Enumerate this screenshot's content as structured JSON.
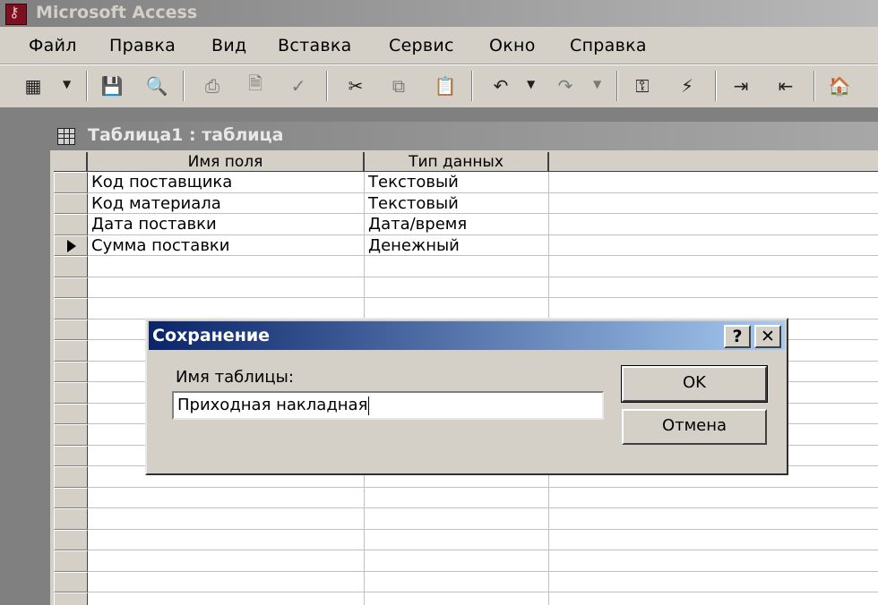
{
  "app": {
    "title": "Microsoft Access"
  },
  "menu": [
    "Файл",
    "Правка",
    "Вид",
    "Вставка",
    "Сервис",
    "Окно",
    "Справка"
  ],
  "toolbar": {
    "icons": [
      "view-icon",
      "save-icon",
      "print-preview-icon",
      "print-icon",
      "preview-icon",
      "spelling-icon",
      "cut-icon",
      "copy-icon",
      "paste-icon",
      "undo-icon",
      "redo-icon",
      "primary-key-icon",
      "indexes-icon",
      "insert-rows-icon",
      "delete-rows-icon",
      "properties-icon"
    ]
  },
  "table_window": {
    "title": "Таблица1 : таблица",
    "columns": [
      "Имя поля",
      "Тип данных"
    ],
    "rows": [
      {
        "field": "Код поставщика",
        "type": "Текстовый"
      },
      {
        "field": "Код материала",
        "type": "Текстовый"
      },
      {
        "field": "Дата поставки",
        "type": "Дата/время"
      },
      {
        "field": "Сумма поставки",
        "type": "Денежный"
      }
    ],
    "current_row": 4
  },
  "dialog": {
    "title": "Сохранение",
    "help_label": "?",
    "close_label": "✕",
    "label": "Имя таблицы:",
    "input_value": "Приходная накладная",
    "ok_label": "OK",
    "cancel_label": "Отмена"
  }
}
